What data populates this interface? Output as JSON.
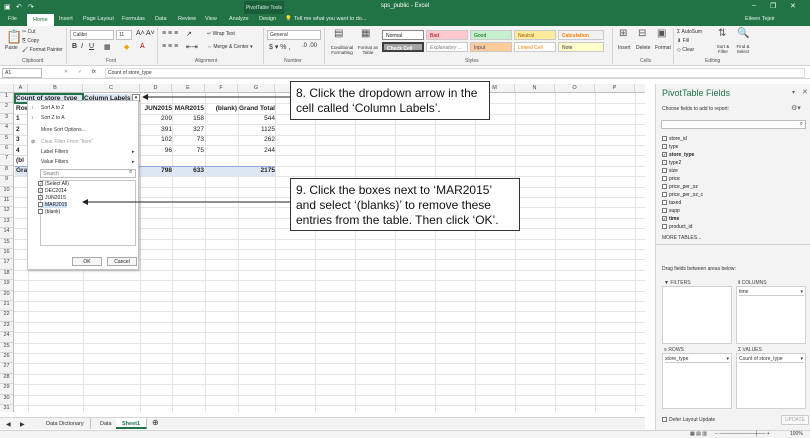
{
  "window": {
    "title": "sps_public - Excel",
    "context": "PivotTable Tools",
    "user": "Eileen Tejeir"
  },
  "tabs": [
    "File",
    "Home",
    "Insert",
    "Page Layout",
    "Formulas",
    "Data",
    "Review",
    "View",
    "Analyze",
    "Design"
  ],
  "tellme": "Tell me what you want to do...",
  "ribbon": {
    "clipboard": {
      "cut": "Cut",
      "copy": "Copy",
      "painter": "Format Painter",
      "paste": "Paste",
      "group": "Clipboard"
    },
    "font": {
      "name": "Calibri",
      "size": "11",
      "group": "Font"
    },
    "alignment": {
      "wrap": "Wrap Text",
      "merge": "Merge & Center",
      "group": "Alignment"
    },
    "number": {
      "format": "General",
      "group": "Number"
    },
    "styles": {
      "cond": "Conditional Formatting",
      "table": "Format as Table",
      "normal": "Normal",
      "bad": "Bad",
      "good": "Good",
      "neutral": "Neutral",
      "calc": "Calculation",
      "check": "Check Cell",
      "expl": "Explanatory ...",
      "input": "Input",
      "linked": "Linked Cell",
      "note": "Note",
      "group": "Styles"
    },
    "cells": {
      "insert": "Insert",
      "delete": "Delete",
      "format": "Format",
      "group": "Cells"
    },
    "editing": {
      "autosum": "AutoSum",
      "fill": "Fill",
      "clear": "Clear",
      "sort": "Sort & Filter",
      "find": "Find & Select",
      "group": "Editing"
    }
  },
  "formula": {
    "namebox": "A1",
    "fx": "fx",
    "value": "Count of store_type"
  },
  "columns": [
    "A",
    "B",
    "C",
    "D",
    "E",
    "F",
    "G",
    "H",
    "I",
    "J",
    "K",
    "L",
    "M",
    "N",
    "O",
    "P",
    "Q"
  ],
  "rows": [
    "1",
    "2",
    "3",
    "4",
    "5",
    "6",
    "7",
    "8",
    "9",
    "10",
    "11",
    "12",
    "13",
    "14",
    "15",
    "16",
    "17",
    "18",
    "19",
    "20",
    "21",
    "22",
    "23",
    "24",
    "25",
    "26",
    "27",
    "28",
    "29",
    "30",
    "31"
  ],
  "pivot": {
    "a1": "Count of store_type",
    "b1": "Column Labels",
    "a2": "Row",
    "headers": [
      "JUN2015",
      "MAR2015",
      "(blank)",
      "Grand Total"
    ],
    "data": [
      [
        "209",
        "158",
        "",
        "544"
      ],
      [
        "391",
        "327",
        "",
        "1125"
      ],
      [
        "102",
        "73",
        "",
        "262"
      ],
      [
        "96",
        "75",
        "",
        "244"
      ],
      [
        "",
        "",
        "",
        ""
      ],
      [
        "798",
        "633",
        "",
        "2175"
      ]
    ],
    "rowlabels": [
      "1",
      "2",
      "3",
      "4",
      "(bl",
      "Gran"
    ]
  },
  "dropdown": {
    "items": [
      "Sort A to Z",
      "Sort Z to A",
      "More Sort Options...",
      "Clear Filter From \"Item\"",
      "Label Filters",
      "Value Filters"
    ],
    "search": "Search",
    "checks": [
      {
        "label": "(Select All)",
        "checked": true
      },
      {
        "label": "DEC2014",
        "checked": true
      },
      {
        "label": "JUN2015",
        "checked": true
      },
      {
        "label": "MAR2015",
        "checked": false
      },
      {
        "label": "(blank)",
        "checked": false
      }
    ],
    "ok": "OK",
    "cancel": "Cancel"
  },
  "callouts": {
    "c8": "8. Click the dropdown arrow in the cell called ‘Column Labels’.",
    "c9": "9. Click the boxes next to ‘MAR2015’ and select ‘(blanks)’ to remove these entries from the table. Then click ‘OK’."
  },
  "sheets": [
    "Data Dictionary",
    "Data",
    "Sheet1"
  ],
  "zoom": "100%",
  "pane": {
    "title": "PivotTable Fields",
    "sub": "Choose fields to add to report:",
    "fields": [
      {
        "name": "store_id",
        "checked": false
      },
      {
        "name": "type",
        "checked": false
      },
      {
        "name": "store_type",
        "checked": true
      },
      {
        "name": "type2",
        "checked": false
      },
      {
        "name": "size",
        "checked": false
      },
      {
        "name": "price",
        "checked": false
      },
      {
        "name": "price_per_oz",
        "checked": false
      },
      {
        "name": "price_per_oz_c",
        "checked": false
      },
      {
        "name": "taxed",
        "checked": false
      },
      {
        "name": "supp",
        "checked": false
      },
      {
        "name": "time",
        "checked": true
      },
      {
        "name": "product_id",
        "checked": false
      }
    ],
    "more": "MORE TABLES...",
    "drag": "Drag fields between areas below:",
    "filters": "FILTERS",
    "columns": "COLUMNS",
    "rows": "ROWS",
    "values": "VALUES",
    "colfield": "time",
    "rowfield": "store_type",
    "valfield": "Count of store_type",
    "defer": "Defer Layout Update",
    "update": "UPDATE"
  }
}
